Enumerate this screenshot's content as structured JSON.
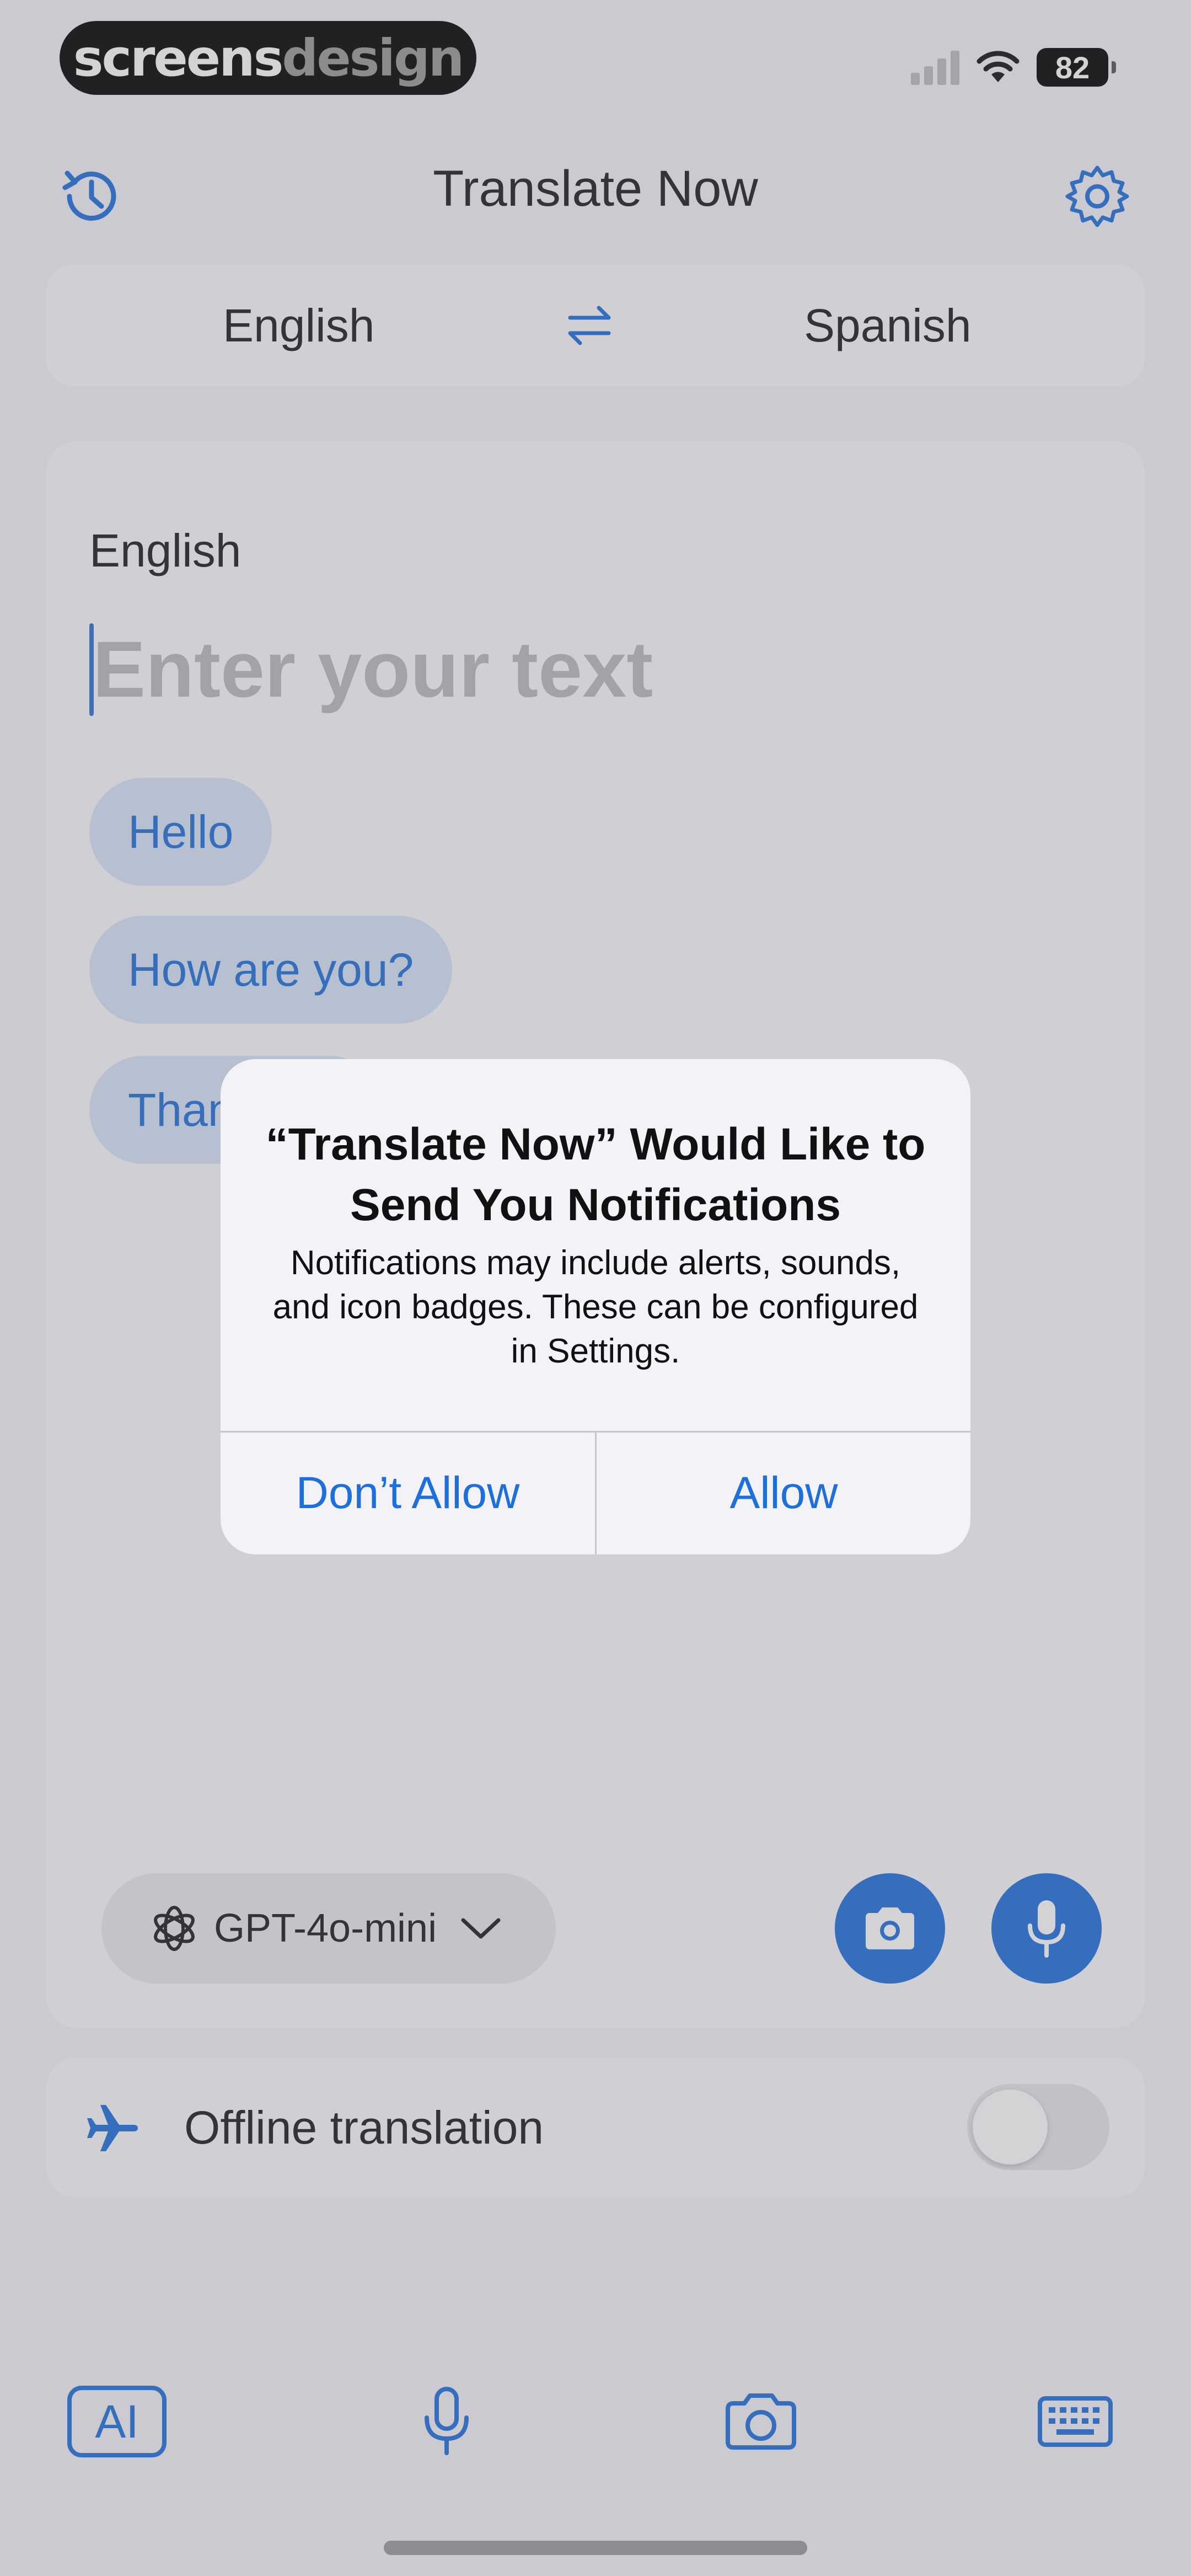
{
  "watermark": {
    "part1": "screens",
    "part2": "design"
  },
  "status_bar": {
    "battery": "82"
  },
  "header": {
    "title": "Translate Now",
    "history_icon": "history-clock-icon",
    "settings_icon": "gear-icon"
  },
  "languages": {
    "source": "English",
    "target": "Spanish",
    "swap_icon": "swap-arrows-icon"
  },
  "input": {
    "source_label": "English",
    "placeholder": "Enter your text",
    "suggestions": [
      "Hello",
      "How are you?",
      "Thank you"
    ]
  },
  "model": {
    "name": "GPT-4o-mini"
  },
  "offline": {
    "label": "Offline translation",
    "enabled": false
  },
  "tab_bar": {
    "ai_label": "AI"
  },
  "alert": {
    "title": "“Translate Now” Would Like to Send You Notifications",
    "message": "Notifications may include alerts, sounds, and icon badges. These can be configured in Settings.",
    "deny": "Don’t Allow",
    "allow": "Allow"
  },
  "colors": {
    "accent": "#1d6fdc",
    "chip_bg": "#d7e4f8",
    "background": "#f2f2f7"
  }
}
